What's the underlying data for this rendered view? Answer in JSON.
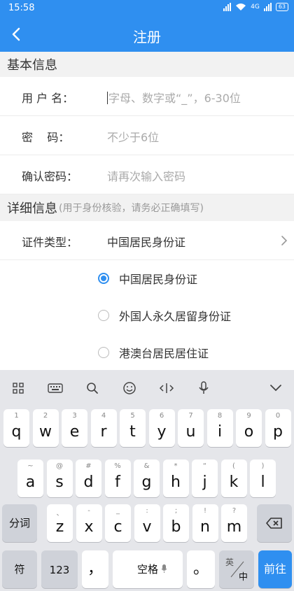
{
  "status": {
    "time": "15:58",
    "net": "4G",
    "battery": "63"
  },
  "nav": {
    "title": "注册"
  },
  "basic": {
    "title": "基本信息"
  },
  "fields": {
    "username": {
      "label": "用 户 名：",
      "placeholder": "字母、数字或“_”，6-30位"
    },
    "password": {
      "label": "密    码：",
      "placeholder": "不少于6位"
    },
    "confirm": {
      "label": "确认密码：",
      "placeholder": "请再次输入密码"
    }
  },
  "detail": {
    "title": "详细信息",
    "note": "(用于身份核验，请务必正确填写)"
  },
  "idtype": {
    "label": "证件类型：",
    "value": "中国居民身份证"
  },
  "options": [
    {
      "label": "中国居民身份证",
      "selected": true
    },
    {
      "label": "外国人永久居留身份证",
      "selected": false
    },
    {
      "label": "港澳台居民居住证",
      "selected": false
    }
  ],
  "keyboard": {
    "row1": [
      {
        "k": "q",
        "s": "1"
      },
      {
        "k": "w",
        "s": "2"
      },
      {
        "k": "e",
        "s": "3"
      },
      {
        "k": "r",
        "s": "4"
      },
      {
        "k": "t",
        "s": "5"
      },
      {
        "k": "y",
        "s": "6"
      },
      {
        "k": "u",
        "s": "7"
      },
      {
        "k": "i",
        "s": "8"
      },
      {
        "k": "o",
        "s": "9"
      },
      {
        "k": "p",
        "s": "0"
      }
    ],
    "row2": [
      {
        "k": "a",
        "s": "~"
      },
      {
        "k": "s",
        "s": "@"
      },
      {
        "k": "d",
        "s": "#"
      },
      {
        "k": "f",
        "s": "%"
      },
      {
        "k": "g",
        "s": "&"
      },
      {
        "k": "h",
        "s": "*"
      },
      {
        "k": "j",
        "s": "“"
      },
      {
        "k": "k",
        "s": "("
      },
      {
        "k": "l",
        "s": ")"
      }
    ],
    "row3": [
      {
        "k": "z",
        "s": "、"
      },
      {
        "k": "x",
        "s": "-"
      },
      {
        "k": "c",
        "s": "_"
      },
      {
        "k": "v",
        "s": ":"
      },
      {
        "k": "b",
        "s": ";"
      },
      {
        "k": "n",
        "s": "!"
      },
      {
        "k": "m",
        "s": "?"
      }
    ],
    "fenci": "分词",
    "fu": "符",
    "num": "123",
    "comma": "，",
    "space": "空格",
    "period": "。",
    "lang_top": "英",
    "lang_bottom": "中",
    "go": "前往"
  }
}
